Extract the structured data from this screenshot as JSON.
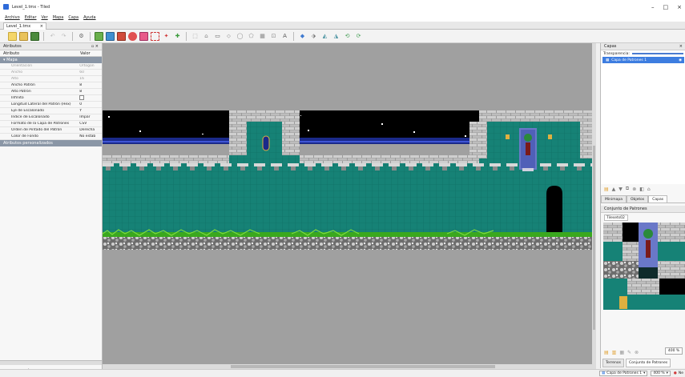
{
  "window": {
    "title": "Level_1.tmx - Tiled",
    "minimize": "–",
    "maximize": "□",
    "close": "×"
  },
  "menu": [
    "Archivo",
    "Editar",
    "Ver",
    "Mapa",
    "Capa",
    "Ayuda"
  ],
  "document_tab": {
    "label": "Level_1.tmx",
    "close": "×"
  },
  "properties_panel": {
    "title": "Atributos",
    "columns": {
      "name": "Atributo",
      "value": "Valor"
    },
    "section_map": "Mapa",
    "rows": [
      {
        "k": "Orientación",
        "v": "Ortogon",
        "disabled": true
      },
      {
        "k": "Ancho",
        "v": "60",
        "disabled": true
      },
      {
        "k": "Alto",
        "v": "16",
        "disabled": true
      },
      {
        "k": "Ancho Patrón",
        "v": "8",
        "disabled": false
      },
      {
        "k": "Alto Patrón",
        "v": "8",
        "disabled": false
      },
      {
        "k": "Infinito",
        "v": "",
        "disabled": false,
        "checkbox": true
      },
      {
        "k": "Longitud Lateral del Patrón (Hex)",
        "v": "0",
        "disabled": false
      },
      {
        "k": "Eje de Escalonado",
        "v": "Y",
        "disabled": false
      },
      {
        "k": "Índice de Escalonado",
        "v": "Impar",
        "disabled": false
      },
      {
        "k": "Formato de la Capa de Patrones",
        "v": "CSV",
        "disabled": false
      },
      {
        "k": "Orden de Pintado del Patrón",
        "v": "Derecha",
        "disabled": false
      },
      {
        "k": "Color de Fondo",
        "v": "No estab",
        "disabled": false
      }
    ],
    "section_custom": "Atributos personalizados"
  },
  "layers_panel": {
    "title": "Capas",
    "opacity_label": "Transparencia:",
    "layer": "Capa de Patrones 1"
  },
  "right_tabs": [
    "Minimapa",
    "Objetos",
    "Capas"
  ],
  "tileset_panel": {
    "title": "Conjunto de Patrones",
    "tileset_tab": "Tilesets02",
    "zoom": "400 %"
  },
  "right_bottom_tabs": [
    "Terrenos",
    "Conjunto de Patrones"
  ],
  "status": {
    "layer": "Capa de Patrones 1",
    "zoom": "400 %",
    "news": "Ne"
  },
  "colors": {
    "sky": "#000000",
    "wall": "#1a8a80",
    "stone": "#9a9a9a",
    "grass": "#3aa81e",
    "banner": "#6a78c8",
    "accent": "#3d7de0"
  }
}
